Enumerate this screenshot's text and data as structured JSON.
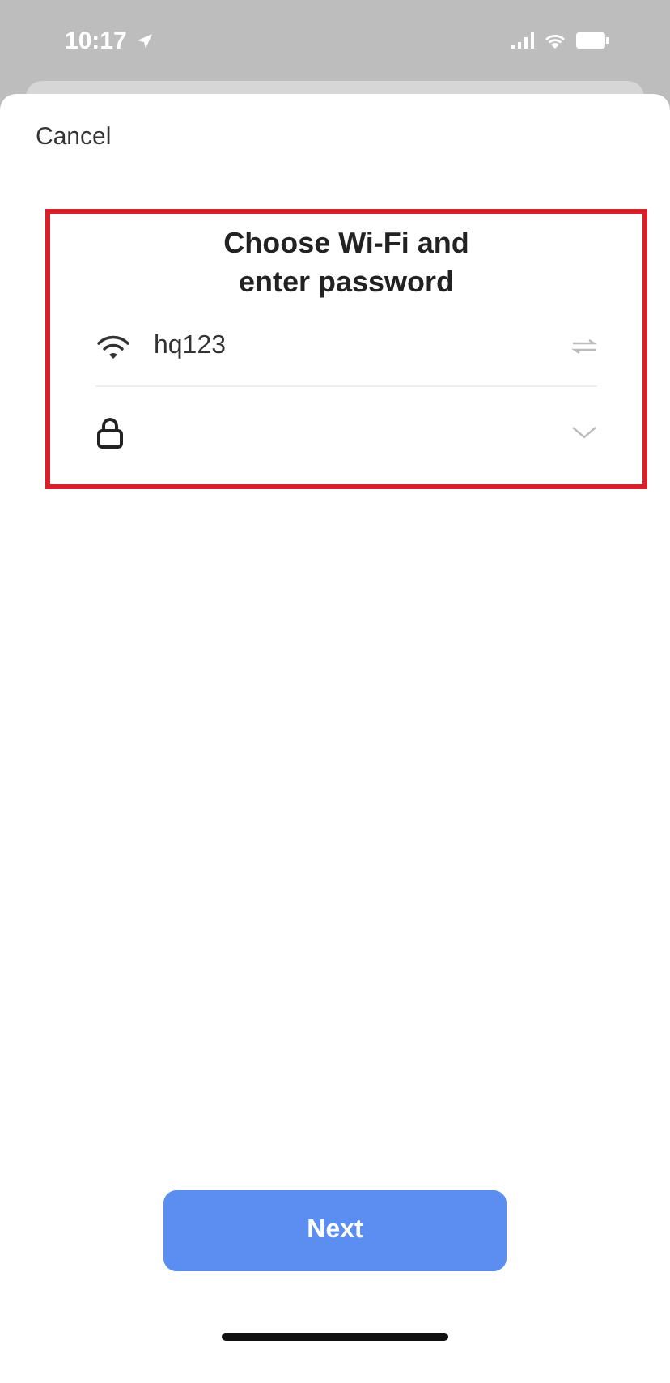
{
  "status_bar": {
    "time": "10:17"
  },
  "cancel": "Cancel",
  "title": "Choose Wi-Fi and enter password",
  "wifi_field": {
    "value": "hq123"
  },
  "next_button": {
    "label": "Next",
    "disabled": true
  }
}
